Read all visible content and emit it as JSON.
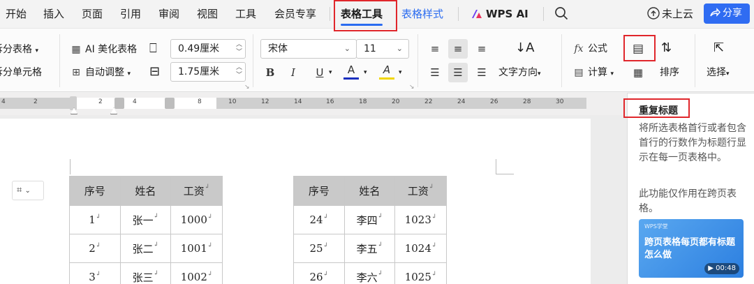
{
  "menu": {
    "items": [
      "开始",
      "插入",
      "页面",
      "引用",
      "审阅",
      "视图",
      "工具",
      "会员专享"
    ],
    "active_tab": "表格工具",
    "style_tab": "表格样式",
    "wps_ai": "WPS AI",
    "search_icon": "search-icon",
    "cloud_label": "未上云",
    "share_label": "分享"
  },
  "ribbon": {
    "split_table": "拆分表格",
    "split_cells": "拆分单元格",
    "ai_beautify": "AI 美化表格",
    "auto_adjust": "自动调整",
    "col_width": "0.49厘米",
    "row_height": "1.75厘米",
    "font_name": "宋体",
    "font_size": "11",
    "bold": "B",
    "italic": "I",
    "underline": "U",
    "font_color": "A",
    "highlight": "A",
    "text_direction": "文字方向",
    "formula": "公式",
    "calculate": "计算",
    "sort": "排序",
    "select": "选择"
  },
  "ruler": {
    "left_ticks": [
      "4",
      "2",
      "2"
    ],
    "ticks": [
      "4",
      "8",
      "10",
      "12",
      "14",
      "16",
      "18",
      "20",
      "22",
      "24",
      "26",
      "28",
      "30"
    ]
  },
  "colors": {
    "accent": "#2b6cf0",
    "highlight_box": "#e0262b",
    "header_fill": "#c9c9c9"
  },
  "table_left": {
    "headers": [
      "序号",
      "姓名",
      "工资"
    ],
    "rows": [
      [
        "1",
        "张一",
        "1000"
      ],
      [
        "2",
        "张二",
        "1001"
      ],
      [
        "3",
        "张三",
        "1002"
      ]
    ]
  },
  "table_right": {
    "headers": [
      "序号",
      "姓名",
      "工资"
    ],
    "rows": [
      [
        "24",
        "李四",
        "1023"
      ],
      [
        "25",
        "李五",
        "1024"
      ],
      [
        "26",
        "李六",
        "1025"
      ]
    ]
  },
  "tooltip": {
    "title": "重复标题",
    "description": "将所选表格首行或者包含首行的行数作为标题行显示在每一页表格中。",
    "note": "此功能仅作用在跨页表格。",
    "video_brand": "WPS学堂",
    "video_title": "跨页表格每页都有标题怎么做",
    "video_duration": "00:48"
  }
}
